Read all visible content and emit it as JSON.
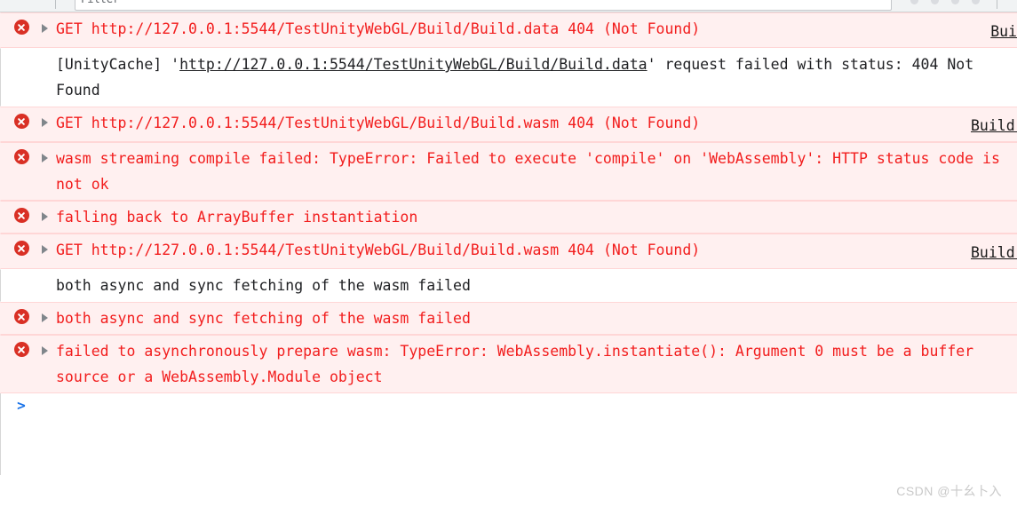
{
  "toolbar": {
    "filter_value": "Filter",
    "filter_placeholder": "Filter"
  },
  "console": {
    "prompt_symbol": ">",
    "messages": [
      {
        "level": "error",
        "icon": "error-circle-icon",
        "expandable": true,
        "method": "GET",
        "url": "http://127.0.0.1:5544/TestUnityWebGL/Build/Build.data",
        "status": "404",
        "status_text": "(Not Found)",
        "source": "Bui"
      },
      {
        "level": "log",
        "icon": "",
        "expandable": false,
        "text_before": "[UnityCache] '",
        "url": "http://127.0.0.1:5544/TestUnityWebGL/Build/Build.data",
        "text_after": "' request failed with status: 404 Not Found",
        "source": ""
      },
      {
        "level": "error",
        "icon": "error-circle-icon",
        "expandable": true,
        "method": "GET",
        "url": "http://127.0.0.1:5544/TestUnityWebGL/Build/Build.wasm",
        "status": "404",
        "status_text": "(Not Found)",
        "source": "Build."
      },
      {
        "level": "error",
        "icon": "error-circle-icon",
        "expandable": true,
        "text": "wasm streaming compile failed: TypeError: Failed to execute 'compile' on 'WebAssembly': HTTP status code is not ok",
        "source": ""
      },
      {
        "level": "error",
        "icon": "error-circle-icon",
        "expandable": true,
        "text": "falling back to ArrayBuffer instantiation",
        "source": ""
      },
      {
        "level": "error",
        "icon": "error-circle-icon",
        "expandable": true,
        "method": "GET",
        "url": "http://127.0.0.1:5544/TestUnityWebGL/Build/Build.wasm",
        "status": "404",
        "status_text": "(Not Found)",
        "source": "Build."
      },
      {
        "level": "log",
        "icon": "",
        "expandable": false,
        "text": "both async and sync fetching of the wasm failed",
        "source": ""
      },
      {
        "level": "error",
        "icon": "error-circle-icon",
        "expandable": true,
        "text": "both async and sync fetching of the wasm failed",
        "source": ""
      },
      {
        "level": "error",
        "icon": "error-circle-icon",
        "expandable": true,
        "text": "failed to asynchronously prepare wasm: TypeError: WebAssembly.instantiate(): Argument 0 must be a buffer source or a WebAssembly.Module object",
        "source": ""
      }
    ]
  },
  "watermark": {
    "text": "CSDN @十幺卜入"
  },
  "colors": {
    "error_bg": "#fff0f0",
    "error_text": "#f21d1d",
    "error_icon": "#d93025",
    "prompt_blue": "#1a73e8",
    "normal_text": "#202124"
  }
}
